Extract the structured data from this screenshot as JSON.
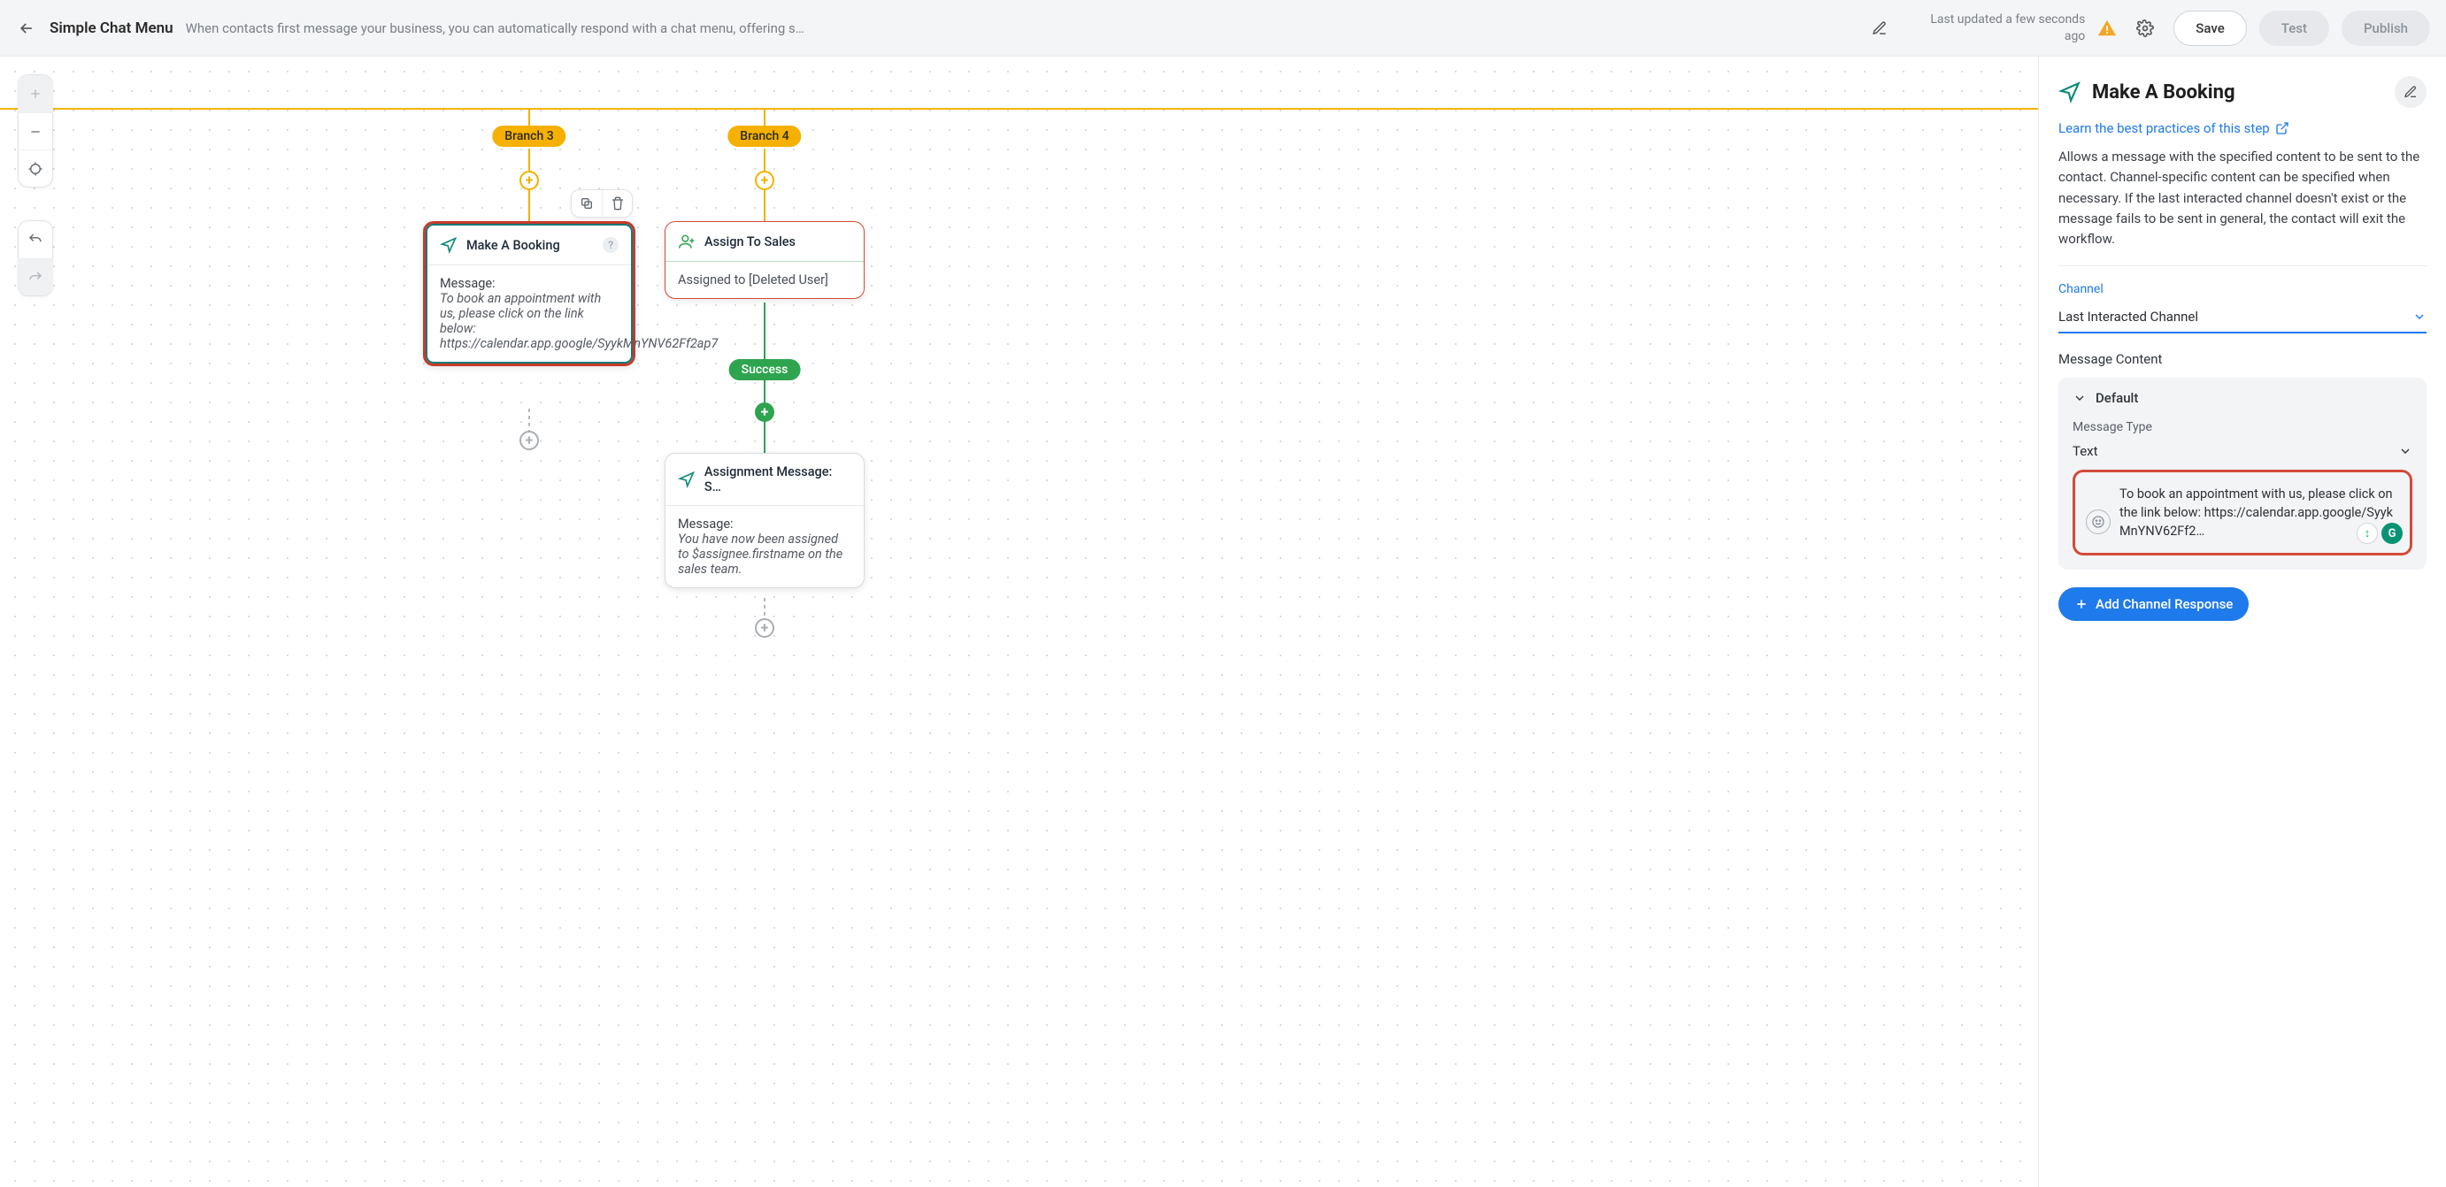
{
  "header": {
    "title": "Simple Chat Menu",
    "description": "When contacts first message your business, you can automatically respond with a chat menu, offering s…",
    "last_updated": "Last updated a few seconds ago",
    "save_label": "Save",
    "test_label": "Test",
    "publish_label": "Publish"
  },
  "canvas": {
    "branch3_label": "Branch 3",
    "branch4_label": "Branch 4",
    "success_label": "Success",
    "node_booking": {
      "title": "Make A Booking",
      "message_label": "Message:",
      "message_body": "To book an appointment with us, please click on the link below: https://calendar.app.google/SyykMnYNV62Ff2ap7"
    },
    "node_assign": {
      "title": "Assign To Sales",
      "body": "Assigned to [Deleted User]"
    },
    "node_msg": {
      "title": "Assignment Message: S…",
      "message_label": "Message:",
      "message_body": "You have now been assigned to $assignee.firstname on the sales team."
    }
  },
  "side": {
    "title": "Make A Booking",
    "learn_link_label": "Learn the best practices of this step",
    "description": "Allows a message with the specified content to be sent to the contact. Channel-specific content can be specified when necessary. If the last interacted channel doesn't exist or the message fails to be sent in general, the contact will exit the workflow.",
    "channel_label": "Channel",
    "channel_value": "Last Interacted Channel",
    "message_content_label": "Message Content",
    "default_label": "Default",
    "message_type_label": "Message Type",
    "message_type_value": "Text",
    "message_text": "To book an appointment with us, please click on the link below: https://calendar.app.google/SyykMnYNV62Ff2…",
    "add_channel_label": "Add Channel Response"
  }
}
